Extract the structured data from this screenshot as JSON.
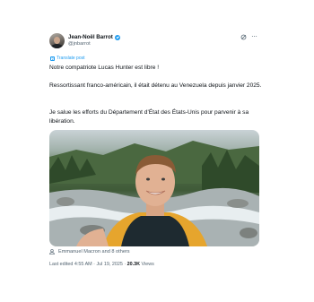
{
  "author": {
    "name": "Jean-Noël Barrot",
    "handle": "@jnbarrot"
  },
  "icons": {
    "verified": "verified-badge-icon",
    "grok": "grok-icon",
    "more": "more-options-icon",
    "translate": "translate-icon",
    "person": "person-icon"
  },
  "colors": {
    "accent": "#1d9bf0",
    "text": "#0f1419",
    "secondary": "#536471"
  },
  "translate_label": "Translate post",
  "post": {
    "line1": "Notre compatriote Lucas Hunter est libre !",
    "line2": "Ressortissant franco-américain, il était détenu au Venezuela depuis janvier 2025.",
    "line3": "Je salue les efforts du Département d'État des États-Unis pour parvenir à sa libération."
  },
  "liked_by": "Emmanuel Macron and 8 others",
  "meta": {
    "prefix": "Last edited",
    "time": "4:55 AM",
    "separator": " · ",
    "date": "Jul 19, 2025",
    "views_count": "20.3K",
    "views_label": "Views"
  }
}
